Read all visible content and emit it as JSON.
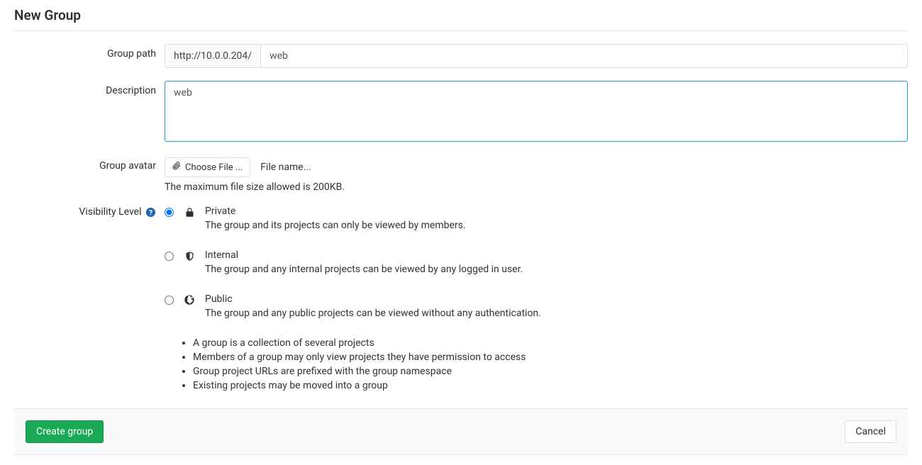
{
  "page": {
    "title": "New Group"
  },
  "form": {
    "path": {
      "label": "Group path",
      "prefix": "http://10.0.0.204/",
      "value": "web"
    },
    "description": {
      "label": "Description",
      "value": "web"
    },
    "avatar": {
      "label": "Group avatar",
      "button": "Choose File ...",
      "placeholder": "File name...",
      "hint": "The maximum file size allowed is 200KB."
    },
    "visibility": {
      "label": "Visibility Level",
      "selected": "private",
      "options": {
        "private": {
          "title": "Private",
          "desc": "The group and its projects can only be viewed by members."
        },
        "internal": {
          "title": "Internal",
          "desc": "The group and any internal projects can be viewed by any logged in user."
        },
        "public": {
          "title": "Public",
          "desc": "The group and any public projects can be viewed without any authentication."
        }
      },
      "info": [
        "A group is a collection of several projects",
        "Members of a group may only view projects they have permission to access",
        "Group project URLs are prefixed with the group namespace",
        "Existing projects may be moved into a group"
      ]
    }
  },
  "actions": {
    "submit": "Create group",
    "cancel": "Cancel"
  }
}
